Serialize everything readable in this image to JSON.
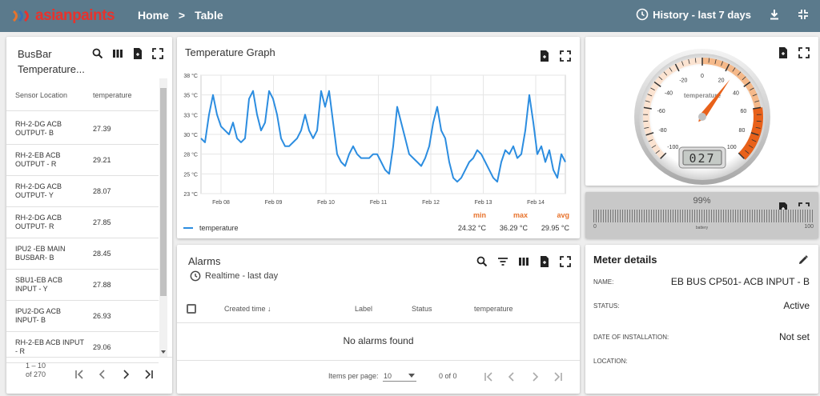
{
  "header": {
    "logo_text": "asianpaints",
    "crumb_home": "Home",
    "crumb_sep": ">",
    "crumb_current": "Table",
    "history_label": "History - last 7 days"
  },
  "sensor_table": {
    "title": "BusBar Temperature...",
    "col_location": "Sensor Location",
    "col_temperature": "temperature",
    "rows": [
      {
        "location": "RH-2-DG ACB OUTPUT- B",
        "value": "27.39"
      },
      {
        "location": "RH-2-EB ACB OUTPUT - R",
        "value": "29.21"
      },
      {
        "location": "RH-2-DG ACB OUTPUT- Y",
        "value": "28.07"
      },
      {
        "location": "RH-2-DG ACB OUTPUT- R",
        "value": "27.85"
      },
      {
        "location": "IPU2 -EB MAIN BUSBAR- B",
        "value": "28.45"
      },
      {
        "location": "SBU1-EB ACB INPUT - Y",
        "value": "27.88"
      },
      {
        "location": "IPU2-DG ACB INPUT- B",
        "value": "26.93"
      },
      {
        "location": "RH-2-EB ACB INPUT - R",
        "value": "29.06"
      }
    ],
    "pager": "1 – 10 of 270"
  },
  "graph": {
    "title": "Temperature Graph",
    "legend": "temperature",
    "min_label": "min",
    "max_label": "max",
    "avg_label": "avg",
    "min": "24.32 °C",
    "max": "36.29 °C",
    "avg": "29.95 °C",
    "line_color": "#2c8de0"
  },
  "chart_data": {
    "type": "line",
    "y_ticks": [
      "38 °C",
      "35 °C",
      "33 °C",
      "30 °C",
      "28 °C",
      "25 °C",
      "23 °C"
    ],
    "x_ticks": [
      "Feb 08",
      "Feb 09",
      "Feb 10",
      "Feb 11",
      "Feb 12",
      "Feb 13",
      "Feb 14"
    ],
    "ylim": [
      23,
      38
    ],
    "series": [
      {
        "name": "temperature",
        "values": [
          30,
          29.5,
          33,
          35.5,
          33,
          31.5,
          31,
          30.5,
          32,
          30,
          29.5,
          30,
          35,
          36,
          33,
          31,
          32,
          36,
          35,
          33,
          30,
          29,
          29,
          29.5,
          30,
          31,
          33,
          31,
          30,
          31,
          36,
          34,
          36,
          32,
          28,
          27,
          26.5,
          28,
          29,
          28,
          27.5,
          27.5,
          27.5,
          28,
          28,
          27,
          26,
          25.5,
          29,
          34,
          32,
          30,
          28,
          27.5,
          27,
          26.5,
          27.5,
          29,
          32,
          34,
          31,
          30,
          27,
          25,
          24.5,
          25,
          26,
          27,
          27.5,
          28.5,
          28,
          27,
          26,
          25,
          24.5,
          27,
          28.5,
          28,
          29,
          27.5,
          28,
          31,
          35.5,
          32,
          28,
          29,
          27,
          28.5,
          26,
          25,
          28,
          27
        ]
      }
    ],
    "grid": true
  },
  "gauge": {
    "unit": "temperature",
    "ticks": [
      "-100",
      "-80",
      "-60",
      "-40",
      "-20",
      "0",
      "20",
      "40",
      "60",
      "80",
      "100"
    ],
    "value": 27,
    "readout": "027"
  },
  "battery": {
    "percent": "99%",
    "level": 99,
    "label": "battery",
    "min": "0",
    "max": "100"
  },
  "alarms": {
    "title": "Alarms",
    "realtime": "Realtime - last day",
    "col_created": "Created time",
    "col_label": "Label",
    "col_status": "Status",
    "col_temperature": "temperature",
    "empty": "No alarms found",
    "items_per_page_label": "Items per page:",
    "items_per_page": "10",
    "range": "0 of 0"
  },
  "meter": {
    "title": "Meter details",
    "name_label": "NAME:",
    "name_value": "EB BUS CP501- ACB INPUT - B",
    "status_label": "STATUS:",
    "status_value": "Active",
    "date_label": "DATE OF INSTALLATION:",
    "date_value": "Not set",
    "location_label": "LOCATION:",
    "location_value": ""
  }
}
